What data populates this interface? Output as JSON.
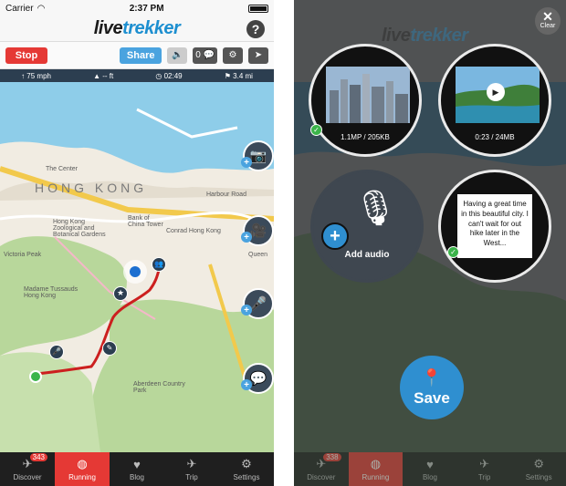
{
  "status": {
    "carrier": "Carrier",
    "time": "2:37 PM"
  },
  "header": {
    "logo_part1": "live",
    "logo_part2": "trekker",
    "help": "?"
  },
  "toolbar": {
    "stop": "Stop",
    "share": "Share",
    "comment_count": "0"
  },
  "stats": {
    "speed": "75 mph",
    "altitude": "-- ft",
    "elapsed": "02:49",
    "distance": "3.4 mi"
  },
  "map": {
    "big_label": "HONG KONG",
    "labels": [
      "The Center",
      "Hong Kong Zoological and Botanical Gardens",
      "Bank of China Tower",
      "Conrad Hong Kong",
      "Victoria Peak",
      "Madame Tussauds Hong Kong",
      "Aberdeen Country Park",
      "Harbour Road",
      "Queen"
    ]
  },
  "tabs": [
    {
      "label": "Discover",
      "icon": "plane-icon",
      "badge": "343"
    },
    {
      "label": "Running",
      "icon": "globe-icon"
    },
    {
      "label": "Blog",
      "icon": "heart-icon"
    },
    {
      "label": "Trip",
      "icon": "plane-icon"
    },
    {
      "label": "Settings",
      "icon": "gear-icon"
    }
  ],
  "right": {
    "clear": "Clear",
    "photo_caption": "1.1MP / 205KB",
    "video_caption": "0:23 / 24MB",
    "add_audio": "Add audio",
    "note_text": "Having a great time in this beautiful city. I can't wait for out hike later in the West...",
    "save": "Save",
    "discover_badge": "338"
  },
  "colors": {
    "accent": "#1d8fd0",
    "stop": "#e53935",
    "route": "#cc1f1f",
    "park": "#b8d79b",
    "water": "#8ecde9"
  }
}
